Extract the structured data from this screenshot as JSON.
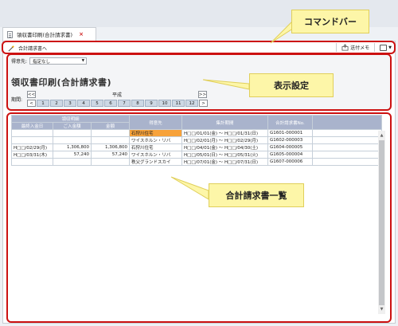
{
  "tab": {
    "title": "領収書印刷(合計請求書)",
    "close": "×"
  },
  "commandbar": {
    "link_label": "合計請求書へ",
    "send_mail_label": "送付メモ"
  },
  "settings": {
    "customer_label": "得意先:",
    "customer_value": "指定なし",
    "page_title": "領収書印刷(合計請求書)",
    "period_label": "期間:",
    "year_label": "平成",
    "year_prev": "<<",
    "year_next": ">>",
    "month_prev": "<",
    "month_next": ">",
    "months": [
      "1",
      "2",
      "3",
      "4",
      "5",
      "6",
      "7",
      "8",
      "9",
      "10",
      "11",
      "12"
    ]
  },
  "callouts": {
    "commandbar": "コマンドバー",
    "display_settings": "表示設定",
    "invoice_list": "合計請求書一覧"
  },
  "table": {
    "group_header": "領収明細",
    "headers": [
      "最終入金日",
      "ご入金額",
      "金額",
      "得意先",
      "集計期間",
      "合計請求書No."
    ],
    "rows": [
      {
        "date": "",
        "paid": "",
        "amount": "",
        "customer": "石狩川住宅",
        "period": "H□□/01/01(金) ～ H□□/01/31(日)",
        "no": "G1601-000001",
        "highlight": true
      },
      {
        "date": "",
        "paid": "",
        "amount": "",
        "customer": "ワイスホルン・リバ",
        "period": "H□□/02/01(月) ～ H□□/02/29(月)",
        "no": "G1602-000003",
        "highlight": false
      },
      {
        "date": "H□□/02/29(月)",
        "paid": "1,306,800",
        "amount": "1,306,800",
        "customer": "石狩川住宅",
        "period": "H□□/04/01(金) ～ H□□/04/30(土)",
        "no": "G1604-000005",
        "highlight": false
      },
      {
        "date": "H□□/03/31(木)",
        "paid": "57,240",
        "amount": "57,240",
        "customer": "ワイスホルン・リバ",
        "period": "H□□/05/01(日) ～ H□□/05/31(火)",
        "no": "G1605-000004",
        "highlight": false
      },
      {
        "date": "",
        "paid": "",
        "amount": "",
        "customer": "秩父グランドスカイ",
        "period": "H□□/07/01(金) ～ H□□/07/31(日)",
        "no": "G1607-000006",
        "highlight": false
      }
    ]
  },
  "colors": {
    "callout_fill": "#fdf6a8",
    "frame_red": "#cc1111",
    "header_fill": "#a9b3cc",
    "highlight": "#f7a23a"
  }
}
